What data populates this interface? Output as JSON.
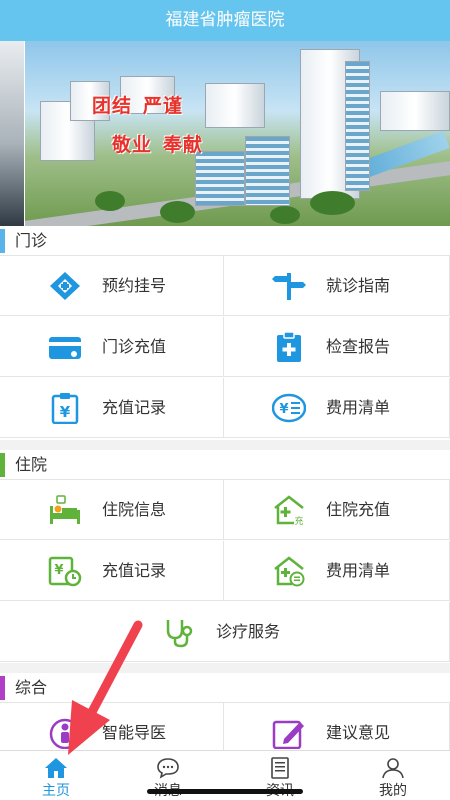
{
  "app": {
    "title": "福建省肿瘤医院"
  },
  "banner": {
    "slogans": [
      "团结",
      "严谨",
      "敬业",
      "奉献"
    ]
  },
  "sections": [
    {
      "title": "门诊",
      "accent": "#5ab4ea",
      "items": [
        {
          "label": "预约挂号",
          "icon": "appointment-icon"
        },
        {
          "label": "就诊指南",
          "icon": "signpost-icon"
        },
        {
          "label": "门诊充值",
          "icon": "card-recharge-icon"
        },
        {
          "label": "检查报告",
          "icon": "report-clipboard-icon"
        },
        {
          "label": "充值记录",
          "icon": "yuan-clipboard-icon"
        },
        {
          "label": "费用清单",
          "icon": "yuan-list-icon"
        }
      ]
    },
    {
      "title": "住院",
      "accent": "#5fb33a",
      "items": [
        {
          "label": "住院信息",
          "icon": "hospital-bed-icon"
        },
        {
          "label": "住院充值",
          "icon": "house-plus-icon"
        },
        {
          "label": "充值记录",
          "icon": "yuan-clock-icon"
        },
        {
          "label": "费用清单",
          "icon": "house-list-icon"
        },
        {
          "label": "诊疗服务",
          "icon": "stethoscope-icon"
        }
      ]
    },
    {
      "title": "综合",
      "accent": "#b03fc7",
      "items": [
        {
          "label": "智能导医",
          "icon": "guide-person-icon"
        },
        {
          "label": "建议意见",
          "icon": "edit-feedback-icon"
        }
      ]
    }
  ],
  "tabs": [
    {
      "label": "主页",
      "icon": "home-icon",
      "active": true
    },
    {
      "label": "消息",
      "icon": "message-icon",
      "active": false
    },
    {
      "label": "资讯",
      "icon": "news-icon",
      "active": false
    },
    {
      "label": "我的",
      "icon": "profile-icon",
      "active": false
    }
  ],
  "colors": {
    "header": "#66c5ee",
    "blue_icon": "#1e96e0",
    "green_icon": "#5fb33a",
    "purple_icon": "#9b3cc4",
    "active_tab": "#1e96e0",
    "arrow": "#f0414f"
  }
}
